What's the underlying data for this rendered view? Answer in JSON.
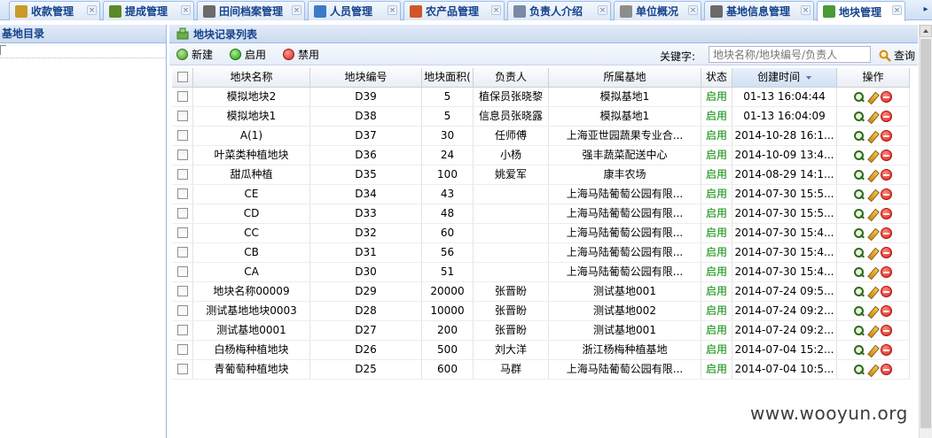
{
  "tabs": [
    {
      "label": "收款管理",
      "icon": "payment-icon",
      "color": "#c89a2a"
    },
    {
      "label": "提成管理",
      "icon": "commission-icon",
      "color": "#5a8a2a"
    },
    {
      "label": "田间档案管理",
      "icon": "field-record-icon",
      "color": "#6b6b6b"
    },
    {
      "label": "人员管理",
      "icon": "people-icon",
      "color": "#3a7bc8"
    },
    {
      "label": "农产品管理",
      "icon": "produce-icon",
      "color": "#d2552a"
    },
    {
      "label": "负责人介绍",
      "icon": "person-card-icon",
      "color": "#7a8aa6"
    },
    {
      "label": "单位概况",
      "icon": "document-icon",
      "color": "#8d8d8d"
    },
    {
      "label": "基地信息管理",
      "icon": "base-info-icon",
      "color": "#6b6b6b"
    },
    {
      "label": "地块管理",
      "icon": "plot-icon",
      "color": "#4a9a3a",
      "active": true
    }
  ],
  "left_panel": {
    "title": "基地目录"
  },
  "main_panel": {
    "title": "地块记录列表"
  },
  "toolbar": {
    "new_label": "新建",
    "enable_label": "启用",
    "disable_label": "禁用",
    "keyword_label": "关键字:",
    "search_placeholder": "地块名称/地块编号/负责人",
    "search_label": "查询"
  },
  "grid": {
    "headers": {
      "name": "地块名称",
      "code": "地块编号",
      "area": "地块面积(",
      "person": "负责人",
      "base": "所属基地",
      "status": "状态",
      "time": "创建时间",
      "ops": "操作"
    },
    "rows": [
      {
        "name": "模拟地块2",
        "code": "D39",
        "area": "5",
        "person": "植保员张晓黎",
        "base": "模拟基地1",
        "status": "启用",
        "time": "01-13 16:04:44"
      },
      {
        "name": "模拟地块1",
        "code": "D38",
        "area": "5",
        "person": "信息员张晓露",
        "base": "模拟基地1",
        "status": "启用",
        "time": "01-13 16:04:09"
      },
      {
        "name": "A(1)",
        "code": "D37",
        "area": "30",
        "person": "任师傅",
        "base": "上海亚世园蔬果专业合...",
        "status": "启用",
        "time": "2014-10-28 16:1..."
      },
      {
        "name": "叶菜类种植地块",
        "code": "D36",
        "area": "24",
        "person": "小杨",
        "base": "强丰蔬菜配送中心",
        "status": "启用",
        "time": "2014-10-09 13:4..."
      },
      {
        "name": "甜瓜种植",
        "code": "D35",
        "area": "100",
        "person": "姚爱军",
        "base": "康丰农场",
        "status": "启用",
        "time": "2014-08-29 14:1..."
      },
      {
        "name": "CE",
        "code": "D34",
        "area": "43",
        "person": "",
        "base": "上海马陆葡萄公园有限...",
        "status": "启用",
        "time": "2014-07-30 15:5..."
      },
      {
        "name": "CD",
        "code": "D33",
        "area": "48",
        "person": "",
        "base": "上海马陆葡萄公园有限...",
        "status": "启用",
        "time": "2014-07-30 15:5..."
      },
      {
        "name": "CC",
        "code": "D32",
        "area": "60",
        "person": "",
        "base": "上海马陆葡萄公园有限...",
        "status": "启用",
        "time": "2014-07-30 15:4..."
      },
      {
        "name": "CB",
        "code": "D31",
        "area": "56",
        "person": "",
        "base": "上海马陆葡萄公园有限...",
        "status": "启用",
        "time": "2014-07-30 15:4..."
      },
      {
        "name": "CA",
        "code": "D30",
        "area": "51",
        "person": "",
        "base": "上海马陆葡萄公园有限...",
        "status": "启用",
        "time": "2014-07-30 15:4..."
      },
      {
        "name": "地块名称00009",
        "code": "D29",
        "area": "20000",
        "person": "张晋盼",
        "base": "测试基地001",
        "status": "启用",
        "time": "2014-07-24 09:5..."
      },
      {
        "name": "测试基地地块0003",
        "code": "D28",
        "area": "10000",
        "person": "张晋盼",
        "base": "测试基地002",
        "status": "启用",
        "time": "2014-07-24 09:2..."
      },
      {
        "name": "测试基地0001",
        "code": "D27",
        "area": "200",
        "person": "张晋盼",
        "base": "测试基地001",
        "status": "启用",
        "time": "2014-07-24 09:2..."
      },
      {
        "name": "白杨梅种植地块",
        "code": "D26",
        "area": "500",
        "person": "刘大洋",
        "base": "浙江杨梅种植基地",
        "status": "启用",
        "time": "2014-07-04 15:2..."
      },
      {
        "name": "青葡萄种植地块",
        "code": "D25",
        "area": "600",
        "person": "马群",
        "base": "上海马陆葡萄公园有限...",
        "status": "启用",
        "time": "2014-07-04 10:5..."
      }
    ]
  },
  "watermark": "www.wooyun.org",
  "colors": {
    "accent": "#15428b",
    "status_on": "#008a00",
    "border": "#99bbe8"
  }
}
